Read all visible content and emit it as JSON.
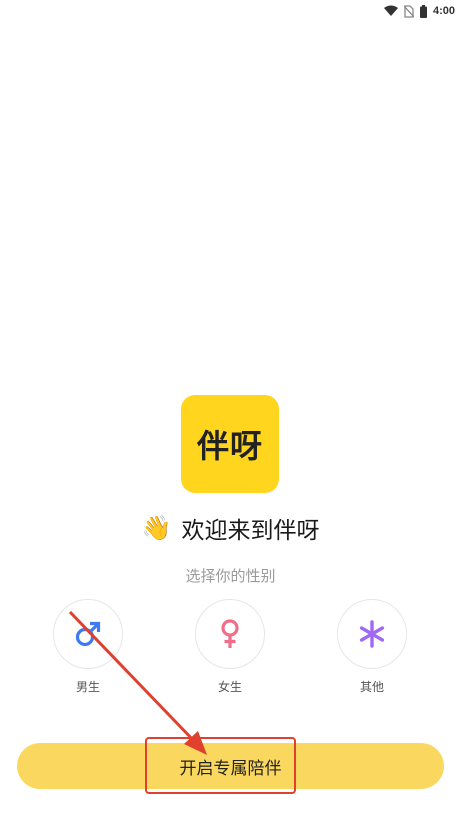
{
  "status_bar": {
    "time": "4:00",
    "icons": [
      "wifi-icon",
      "no-sim-icon",
      "battery-icon"
    ]
  },
  "app": {
    "logo_text": "伴呀",
    "welcome_emoji": "👋",
    "welcome_text": "欢迎来到伴呀",
    "subtitle": "选择你的性别"
  },
  "genders": [
    {
      "label": "男生",
      "icon": "male-symbol-icon",
      "color": "#3E7BF0"
    },
    {
      "label": "女生",
      "icon": "female-symbol-icon",
      "color": "#F36C8A"
    },
    {
      "label": "其他",
      "icon": "asterisk-icon",
      "color": "#A168F5"
    }
  ],
  "actions": {
    "start_label": "开启专属陪伴"
  },
  "colors": {
    "brand_yellow": "#FFD51E",
    "button_yellow": "#FAD860",
    "annotation_red": "#E0402E"
  }
}
